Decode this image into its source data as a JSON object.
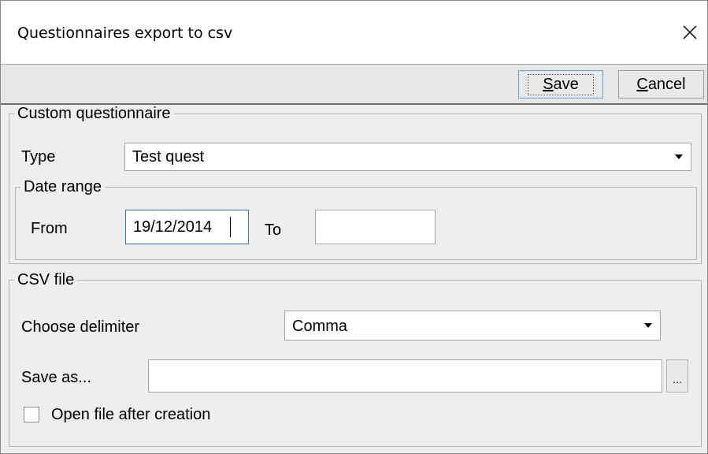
{
  "window": {
    "title": "Questionnaires export to csv",
    "close_icon": "close-icon"
  },
  "toolbar": {
    "save_label": "Save",
    "save_mnemonic": "S",
    "cancel_label": "Cancel",
    "cancel_mnemonic": "C"
  },
  "custom_questionnaire": {
    "legend": "Custom questionnaire",
    "type_label": "Type",
    "type_value": "Test quest",
    "date_range": {
      "legend": "Date range",
      "from_label": "From",
      "from_value": "19/12/2014",
      "to_label": "To",
      "to_value": ""
    }
  },
  "csv_file": {
    "legend": "CSV file",
    "delimiter_label": "Choose delimiter",
    "delimiter_value": "Comma",
    "save_as_label": "Save as...",
    "save_as_value": "",
    "browse_label": "...",
    "open_after_label": "Open file after creation",
    "open_after_checked": false
  },
  "colors": {
    "focus_border": "#3b6fb6",
    "panel_bg": "#eeeeee"
  }
}
